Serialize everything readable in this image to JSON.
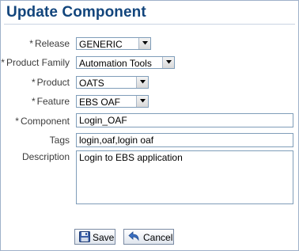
{
  "page": {
    "title": "Update Component"
  },
  "form": {
    "required_marker": "*",
    "release": {
      "label": "Release",
      "value": "GENERIC"
    },
    "product_family": {
      "label": "Product Family",
      "value": "Automation Tools"
    },
    "product": {
      "label": "Product",
      "value": "OATS"
    },
    "feature": {
      "label": "Feature",
      "value": "EBS OAF"
    },
    "component": {
      "label": "Component",
      "value": "Login_OAF"
    },
    "tags": {
      "label": "Tags",
      "value": "login,oaf,login oaf"
    },
    "description": {
      "label": "Description",
      "value": "Login to EBS application"
    }
  },
  "actions": {
    "save_label": "Save",
    "cancel_label": "Cancel"
  },
  "colors": {
    "title": "#12457c",
    "field_border": "#7f9db9",
    "frame_border": "#9fb1c9"
  },
  "icons": {
    "save": "floppy-disk-icon",
    "cancel": "undo-arrow-icon",
    "dropdown": "chevron-down-icon"
  }
}
